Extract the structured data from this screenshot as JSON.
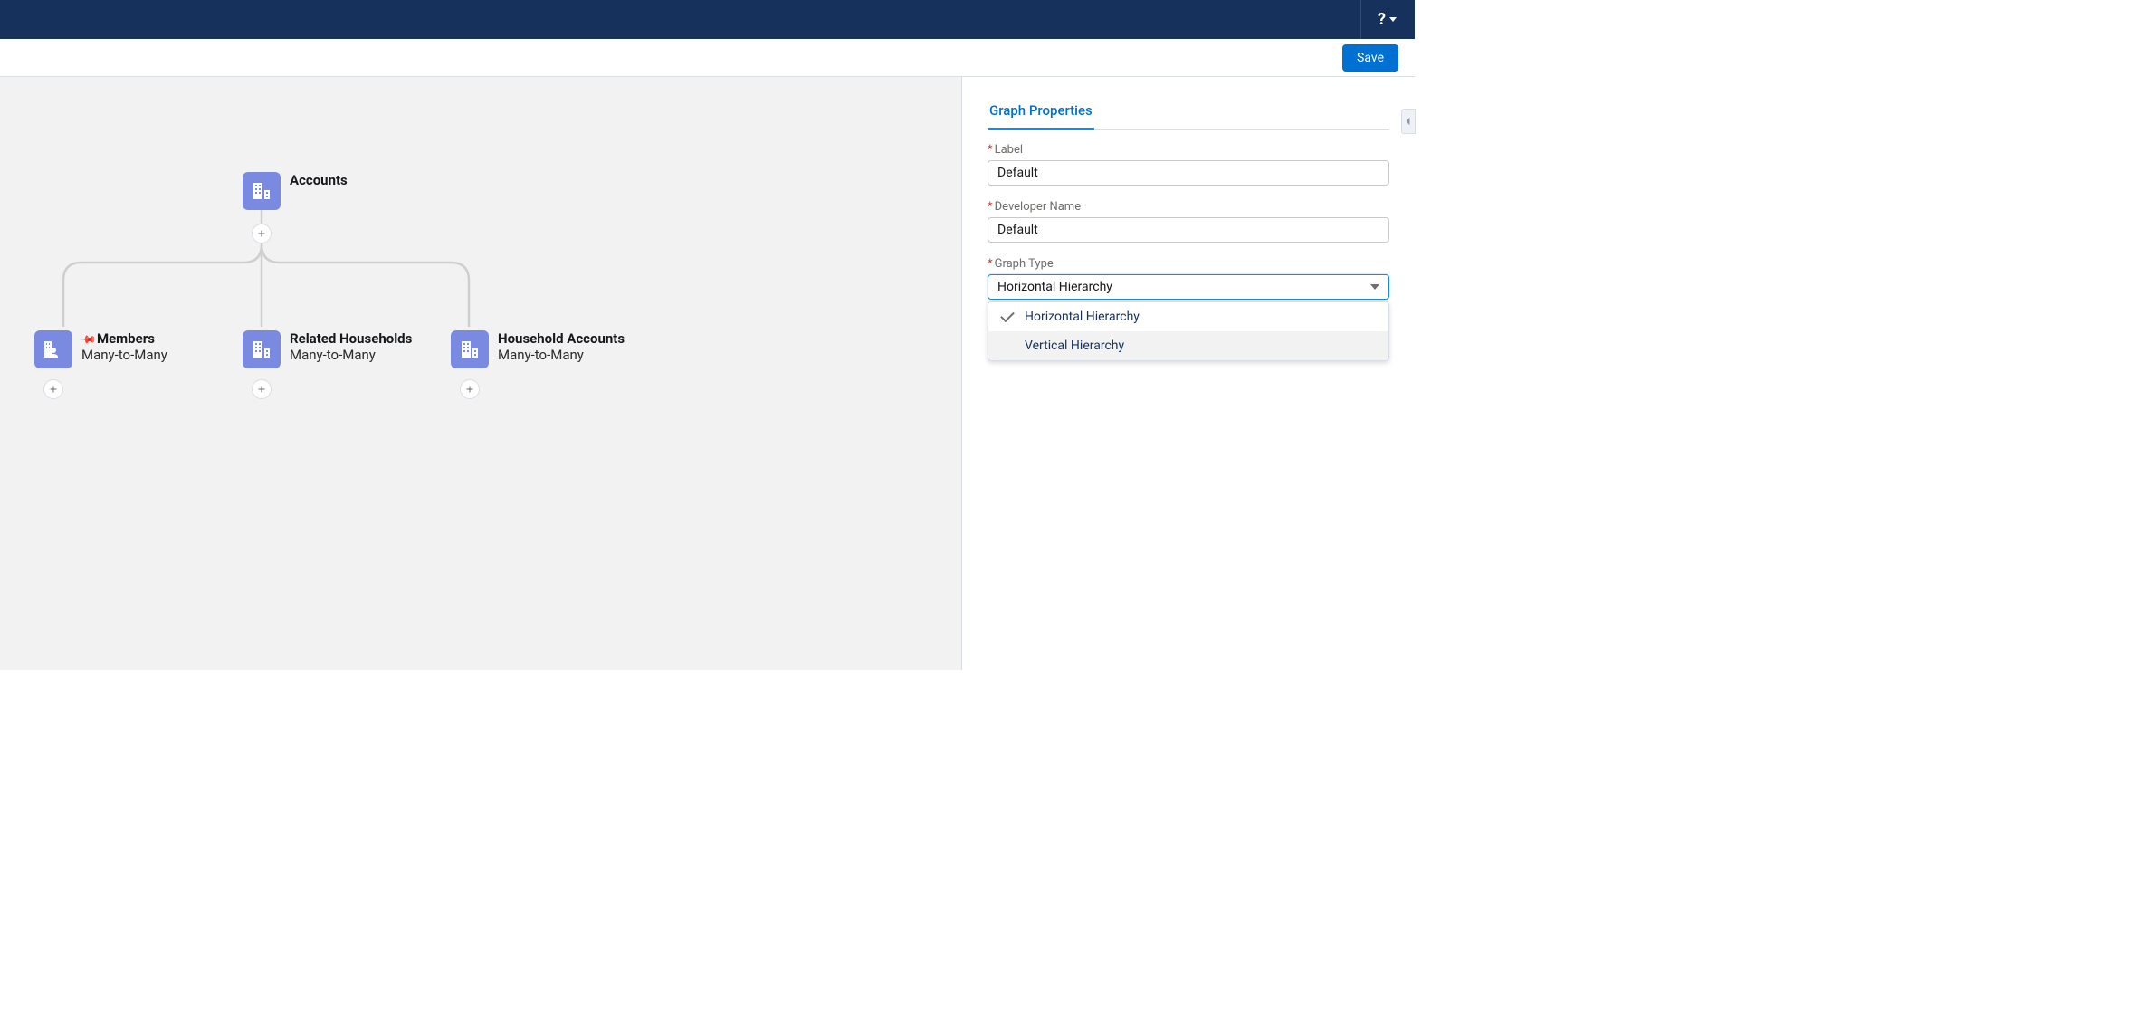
{
  "topbar": {
    "help_label": "?"
  },
  "savebar": {
    "save_label": "Save"
  },
  "canvas": {
    "root": {
      "title": "Accounts"
    },
    "children": [
      {
        "title": "Members",
        "sub": "Many-to-Many",
        "pinned": true
      },
      {
        "title": "Related Households",
        "sub": "Many-to-Many",
        "pinned": false
      },
      {
        "title": "Household Accounts",
        "sub": "Many-to-Many",
        "pinned": false
      }
    ]
  },
  "properties": {
    "tab_label": "Graph Properties",
    "fields": {
      "label": {
        "label": "Label",
        "value": "Default"
      },
      "developer_name": {
        "label": "Developer Name",
        "value": "Default"
      },
      "graph_type": {
        "label": "Graph Type",
        "value": "Horizontal Hierarchy"
      }
    },
    "graph_type_options": [
      "Horizontal Hierarchy",
      "Vertical Hierarchy"
    ]
  }
}
